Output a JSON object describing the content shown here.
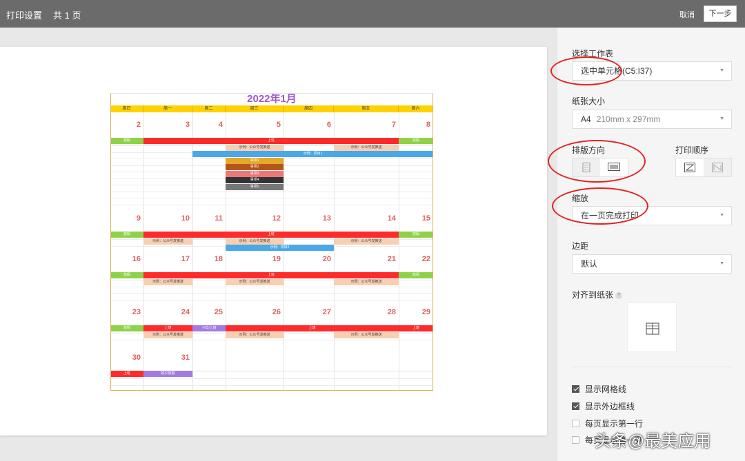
{
  "topbar": {
    "title": "打印设置",
    "pages": "共 1 页",
    "cancel": "取消",
    "next": "下一步"
  },
  "calendar": {
    "title": "2022年1月",
    "weekdays": [
      "周日",
      "周一",
      "周二",
      "周三",
      "周四",
      "周五",
      "周六"
    ],
    "days": [
      "2",
      "3",
      "4",
      "5",
      "6",
      "7",
      "8",
      "9",
      "10",
      "11",
      "12",
      "13",
      "14",
      "15",
      "16",
      "17",
      "18",
      "19",
      "20",
      "21",
      "22",
      "23",
      "24",
      "25",
      "26",
      "27",
      "28",
      "29",
      "30",
      "31"
    ],
    "labels": {
      "rest": "放假",
      "work": "上班",
      "example": "示例：公众号发推送",
      "project1": "示例：项目1",
      "project2": "示例：项目2",
      "tasks": [
        "事项1",
        "事项2",
        "事项3",
        "事项4",
        "事项5"
      ],
      "small_year": "小年/上班",
      "eve_holiday": "除夕放假"
    }
  },
  "settings": {
    "sheet_label": "选择工作表",
    "sheet_value": "选中单元格(C5:I37)",
    "paper_label": "纸张大小",
    "paper_value": "A4",
    "paper_dims": "210mm x 297mm",
    "orientation_label": "排版方向",
    "order_label": "打印顺序",
    "scale_label": "缩放",
    "scale_value": "在一页完成打印",
    "margin_label": "边距",
    "margin_value": "默认",
    "align_label": "对齐到纸张",
    "help_mark": "?",
    "gridlines": "显示网格线",
    "border": "显示外边框线",
    "first_row": "每页显示第一行",
    "first_col": "每页显示第一列"
  },
  "watermark": "头条@最美应用",
  "colors": {
    "accent_red": "#e42222",
    "rest": "#8fd24a",
    "work": "#ff2a2a",
    "project": "#4aa8e8",
    "title": "#9b59d0"
  }
}
